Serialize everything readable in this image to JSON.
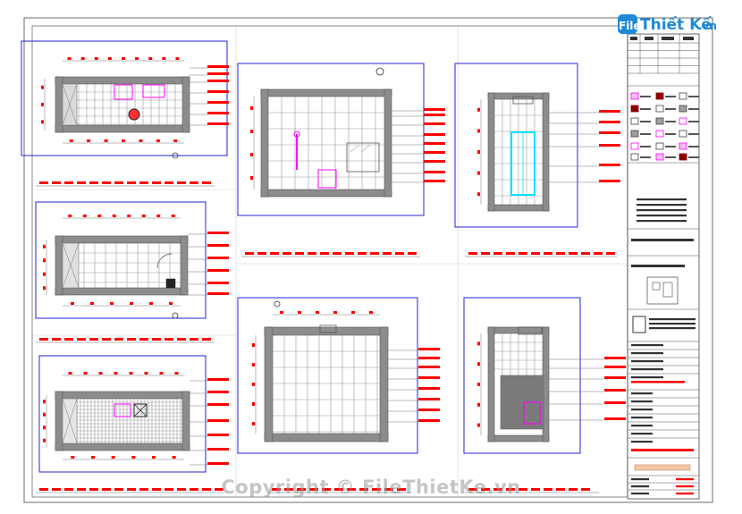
{
  "logo": {
    "part1": "File",
    "part2": "Thiết Kế",
    "part3": ".vn"
  },
  "watermark": "Copyright © FileThietKe.vn",
  "colors": {
    "background": "#ffffff",
    "frame": "#6b6b6b",
    "wall": "#555555",
    "wall_fill": "#8c8c8c",
    "tile": "#9a9a9a",
    "dimension_red": "#ff0000",
    "viewport_blue": "#2323d8",
    "fixture_magenta": "#ff00ff",
    "accent_cyan": "#00e5ff",
    "logo_blue": "#1f8bd8"
  }
}
